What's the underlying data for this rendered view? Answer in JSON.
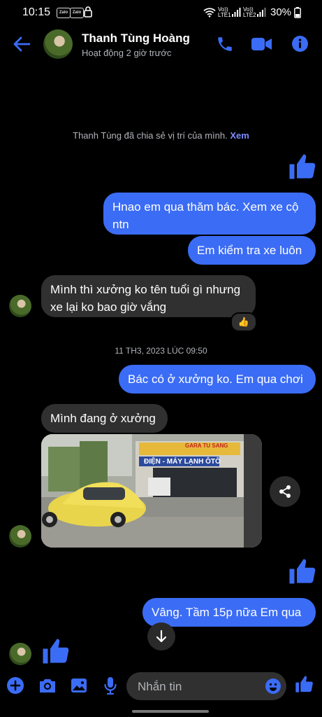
{
  "status_bar": {
    "time": "10:15",
    "app_badge_1": "Zalo",
    "app_badge_2": "Zalo",
    "sim1": "Vo)) LTE1",
    "sim2": "Vo)) LTE2",
    "battery": "30%"
  },
  "header": {
    "name": "Thanh Tùng Hoàng",
    "status": "Hoạt động 2 giờ trước"
  },
  "conversation": {
    "location_notice": "Thanh Tùng đã chia sẻ vị trí của mình.",
    "location_link": "Xem",
    "msg1_line1": "Hnao em qua thăm bác. Xem xe cộ",
    "msg1_line2": "ntn",
    "msg2": "Em kiểm tra xe luôn",
    "msg3_line1": "Mình thì xưởng ko tên tuổi gì nhưng",
    "msg3_line2": "xe lại ko bao giờ vắng",
    "msg3_reaction": "👍",
    "timestamp": "11 TH3, 2023 LÚC 09:50",
    "msg4": "Bác có ở xưởng ko. Em qua chơi",
    "msg5": "Mình đang ở xưởng",
    "photo_sign_1": "GARA TU SANG",
    "photo_sign_2": "ĐIỆN - MÁY LẠNH ÔTÔ",
    "msg6": "Vâng. Tầm 15p nữa Em qua"
  },
  "composer": {
    "placeholder": "Nhắn tin"
  },
  "colors": {
    "accent": "#3b6cf5",
    "incoming": "#303030",
    "link": "#7d8cff"
  }
}
